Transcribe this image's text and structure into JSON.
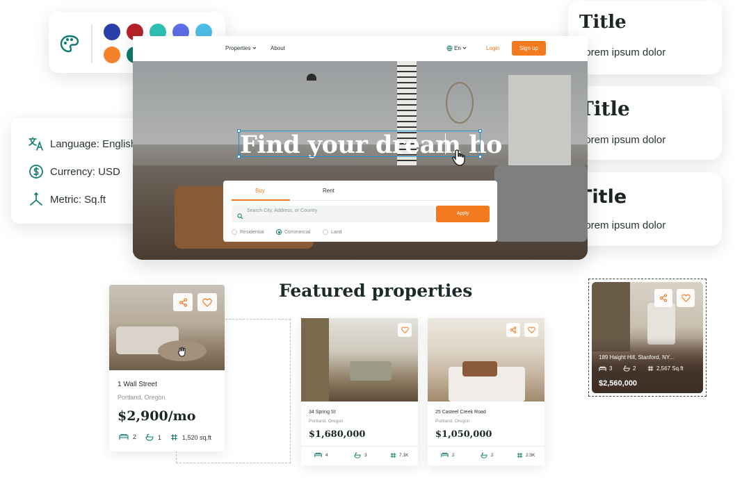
{
  "palette": {
    "icon": "palette-icon",
    "colors": [
      "#2a3fa8",
      "#b52129",
      "#2fc0b4",
      "#5d6ee8",
      "#4fbde9",
      "#f4822a",
      "#0f7a6e",
      "#5a78f2",
      "#f47f72",
      "#c79a34"
    ]
  },
  "settings": {
    "items": [
      {
        "label": "Language: English",
        "icon": "translate-icon"
      },
      {
        "label": "Currency: USD",
        "icon": "dollar-circle-icon"
      },
      {
        "label": "Metric: Sq.ft",
        "icon": "metric-axes-icon"
      }
    ]
  },
  "title_cards": [
    {
      "title": "Title",
      "subtitle": "Lorem ipsum dolor"
    },
    {
      "title": "Title",
      "subtitle": "Lorem ipsum dolor"
    },
    {
      "title": "Title",
      "subtitle": "Lorem ipsum dolor"
    }
  ],
  "nav": {
    "properties": "Properties",
    "about": "About",
    "lang": "En",
    "login": "Login",
    "signup": "Sign up"
  },
  "hero": {
    "headline": "Find your dream ho"
  },
  "search": {
    "tabs": [
      "Buy",
      "Rent"
    ],
    "placeholder": "Search City, Address, or Country",
    "apply": "Apply",
    "types": [
      "Residential",
      "Commercial",
      "Land"
    ],
    "selected_type": "Commercial"
  },
  "featured": {
    "title": "Featured properties"
  },
  "properties": [
    {
      "address": "1 Wall Street",
      "city": "Portland, Oregon",
      "price": "$2,900/mo",
      "beds": "2",
      "baths": "1",
      "area": "1,520 sq.ft"
    },
    {
      "address": "34 Spring St",
      "city": "Portland, Oregon",
      "price": "$1,680,000",
      "beds": "4",
      "baths": "3",
      "area": "7.1K"
    },
    {
      "address": "25 Casteel Creek Road",
      "city": "Portland, Oregon",
      "price": "$1,050,000",
      "beds": "2",
      "baths": "2",
      "area": "2.3K"
    },
    {
      "address": "189 Haight Hill, Stanford, NY...",
      "price": "$2,560,000",
      "beds": "3",
      "baths": "2",
      "area": "2,567 Sq.ft"
    }
  ],
  "colors": {
    "accent": "#f47a20",
    "teal": "#0f7a6e",
    "selection": "#1f8fd0"
  }
}
